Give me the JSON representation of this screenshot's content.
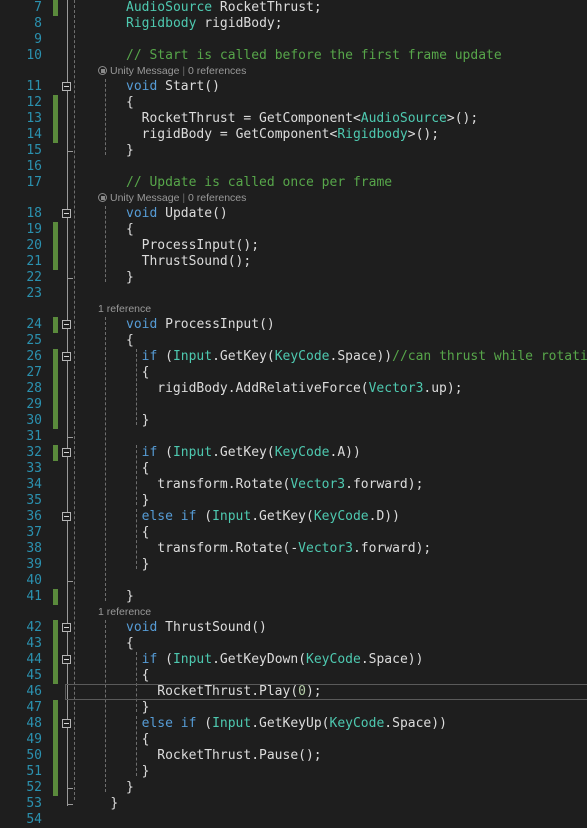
{
  "editor": {
    "name": "visual-studio-code-editor",
    "language": "csharp",
    "background_color": "#1e1e1e",
    "line_number_color": "#2b91af",
    "change_bar_color": "#5a8a3c",
    "current_line": 46,
    "first_line": 7,
    "last_line": 54,
    "colors": {
      "keyword": "#569cd6",
      "type": "#4ec9b0",
      "comment": "#57a64a",
      "identifier": "#dcdcdc",
      "number": "#b5cea8",
      "codelens": "#999999"
    },
    "codelens": [
      {
        "above_line": 11,
        "icon": "unity-message-icon",
        "label": "Unity Message",
        "separator": "|",
        "references": "0 references"
      },
      {
        "above_line": 18,
        "icon": "unity-message-icon",
        "label": "Unity Message",
        "separator": "|",
        "references": "0 references"
      },
      {
        "above_line": 24,
        "icon": null,
        "label": null,
        "separator": null,
        "references": "1 reference"
      },
      {
        "above_line": 42,
        "icon": null,
        "label": null,
        "separator": null,
        "references": "1 reference"
      }
    ],
    "lines": [
      {
        "n": 7,
        "indent": 2,
        "changed": true,
        "fold": null,
        "tokens": [
          {
            "t": "AudioSource",
            "c": "type"
          },
          {
            "t": " ",
            "c": "punc"
          },
          {
            "t": "RocketThrust;",
            "c": "id"
          }
        ]
      },
      {
        "n": 8,
        "indent": 2,
        "changed": false,
        "fold": null,
        "tokens": [
          {
            "t": "Rigidbody",
            "c": "type"
          },
          {
            "t": " ",
            "c": "punc"
          },
          {
            "t": "rigidBody;",
            "c": "id"
          }
        ]
      },
      {
        "n": 9,
        "indent": 2,
        "changed": false,
        "fold": null,
        "tokens": []
      },
      {
        "n": 10,
        "indent": 2,
        "changed": false,
        "fold": null,
        "tokens": [
          {
            "t": "// Start is called before the first frame update",
            "c": "cmt"
          }
        ]
      },
      {
        "n": 11,
        "indent": 2,
        "changed": false,
        "fold": "open",
        "tokens": [
          {
            "t": "void",
            "c": "kw"
          },
          {
            "t": " ",
            "c": "punc"
          },
          {
            "t": "Start",
            "c": "id"
          },
          {
            "t": "()",
            "c": "punc"
          }
        ]
      },
      {
        "n": 12,
        "indent": 2,
        "changed": true,
        "fold": null,
        "tokens": [
          {
            "t": "{",
            "c": "punc"
          }
        ]
      },
      {
        "n": 13,
        "indent": 3,
        "changed": true,
        "fold": null,
        "tokens": [
          {
            "t": "RocketThrust ",
            "c": "id"
          },
          {
            "t": "= ",
            "c": "punc"
          },
          {
            "t": "GetComponent",
            "c": "id"
          },
          {
            "t": "<",
            "c": "punc"
          },
          {
            "t": "AudioSource",
            "c": "type"
          },
          {
            "t": ">();",
            "c": "punc"
          }
        ]
      },
      {
        "n": 14,
        "indent": 3,
        "changed": true,
        "fold": null,
        "tokens": [
          {
            "t": "rigidBody ",
            "c": "id"
          },
          {
            "t": "= ",
            "c": "punc"
          },
          {
            "t": "GetComponent",
            "c": "id"
          },
          {
            "t": "<",
            "c": "punc"
          },
          {
            "t": "Rigidbody",
            "c": "type"
          },
          {
            "t": ">();",
            "c": "punc"
          }
        ]
      },
      {
        "n": 15,
        "indent": 2,
        "changed": false,
        "fold": "end",
        "tokens": [
          {
            "t": "}",
            "c": "punc"
          }
        ]
      },
      {
        "n": 16,
        "indent": 2,
        "changed": false,
        "fold": null,
        "tokens": []
      },
      {
        "n": 17,
        "indent": 2,
        "changed": false,
        "fold": null,
        "tokens": [
          {
            "t": "// Update is called once per frame",
            "c": "cmt"
          }
        ]
      },
      {
        "n": 18,
        "indent": 2,
        "changed": false,
        "fold": "open",
        "tokens": [
          {
            "t": "void",
            "c": "kw"
          },
          {
            "t": " ",
            "c": "punc"
          },
          {
            "t": "Update",
            "c": "id"
          },
          {
            "t": "()",
            "c": "punc"
          }
        ]
      },
      {
        "n": 19,
        "indent": 2,
        "changed": true,
        "fold": null,
        "tokens": [
          {
            "t": "{",
            "c": "punc"
          }
        ]
      },
      {
        "n": 20,
        "indent": 3,
        "changed": true,
        "fold": null,
        "tokens": [
          {
            "t": "ProcessInput",
            "c": "id"
          },
          {
            "t": "();",
            "c": "punc"
          }
        ]
      },
      {
        "n": 21,
        "indent": 3,
        "changed": true,
        "fold": null,
        "tokens": [
          {
            "t": "ThrustSound",
            "c": "id"
          },
          {
            "t": "();",
            "c": "punc"
          }
        ]
      },
      {
        "n": 22,
        "indent": 2,
        "changed": false,
        "fold": "end",
        "tokens": [
          {
            "t": "}",
            "c": "punc"
          }
        ]
      },
      {
        "n": 23,
        "indent": 2,
        "changed": false,
        "fold": null,
        "tokens": []
      },
      {
        "n": 24,
        "indent": 2,
        "changed": true,
        "fold": "open",
        "tokens": [
          {
            "t": "void",
            "c": "kw"
          },
          {
            "t": " ",
            "c": "punc"
          },
          {
            "t": "ProcessInput",
            "c": "id"
          },
          {
            "t": "()",
            "c": "punc"
          }
        ]
      },
      {
        "n": 25,
        "indent": 2,
        "changed": false,
        "fold": null,
        "tokens": [
          {
            "t": "{",
            "c": "punc"
          }
        ]
      },
      {
        "n": 26,
        "indent": 3,
        "changed": true,
        "fold": "open",
        "tokens": [
          {
            "t": "if",
            "c": "kw"
          },
          {
            "t": " (",
            "c": "punc"
          },
          {
            "t": "Input",
            "c": "type"
          },
          {
            "t": ".",
            "c": "punc"
          },
          {
            "t": "GetKey",
            "c": "id"
          },
          {
            "t": "(",
            "c": "punc"
          },
          {
            "t": "KeyCode",
            "c": "type"
          },
          {
            "t": ".",
            "c": "punc"
          },
          {
            "t": "Space",
            "c": "id"
          },
          {
            "t": "))",
            "c": "punc"
          },
          {
            "t": "//can thrust while rotating",
            "c": "cmt"
          }
        ]
      },
      {
        "n": 27,
        "indent": 3,
        "changed": true,
        "fold": null,
        "tokens": [
          {
            "t": "{",
            "c": "punc"
          }
        ]
      },
      {
        "n": 28,
        "indent": 4,
        "changed": true,
        "fold": null,
        "tokens": [
          {
            "t": "rigidBody",
            "c": "id"
          },
          {
            "t": ".",
            "c": "punc"
          },
          {
            "t": "AddRelativeForce",
            "c": "id"
          },
          {
            "t": "(",
            "c": "punc"
          },
          {
            "t": "Vector3",
            "c": "type"
          },
          {
            "t": ".",
            "c": "punc"
          },
          {
            "t": "up);",
            "c": "id"
          }
        ]
      },
      {
        "n": 29,
        "indent": 4,
        "changed": true,
        "fold": null,
        "tokens": []
      },
      {
        "n": 30,
        "indent": 3,
        "changed": true,
        "fold": null,
        "tokens": [
          {
            "t": "}",
            "c": "punc"
          }
        ]
      },
      {
        "n": 31,
        "indent": 3,
        "changed": false,
        "fold": "end",
        "tokens": []
      },
      {
        "n": 32,
        "indent": 3,
        "changed": true,
        "fold": "open",
        "tokens": [
          {
            "t": "if",
            "c": "kw"
          },
          {
            "t": " (",
            "c": "punc"
          },
          {
            "t": "Input",
            "c": "type"
          },
          {
            "t": ".",
            "c": "punc"
          },
          {
            "t": "GetKey",
            "c": "id"
          },
          {
            "t": "(",
            "c": "punc"
          },
          {
            "t": "KeyCode",
            "c": "type"
          },
          {
            "t": ".",
            "c": "punc"
          },
          {
            "t": "A",
            "c": "id"
          },
          {
            "t": "))",
            "c": "punc"
          }
        ]
      },
      {
        "n": 33,
        "indent": 3,
        "changed": false,
        "fold": null,
        "tokens": [
          {
            "t": "{",
            "c": "punc"
          }
        ]
      },
      {
        "n": 34,
        "indent": 4,
        "changed": false,
        "fold": null,
        "tokens": [
          {
            "t": "transform",
            "c": "id"
          },
          {
            "t": ".",
            "c": "punc"
          },
          {
            "t": "Rotate",
            "c": "id"
          },
          {
            "t": "(",
            "c": "punc"
          },
          {
            "t": "Vector3",
            "c": "type"
          },
          {
            "t": ".",
            "c": "punc"
          },
          {
            "t": "forward);",
            "c": "id"
          }
        ]
      },
      {
        "n": 35,
        "indent": 3,
        "changed": false,
        "fold": null,
        "tokens": [
          {
            "t": "}",
            "c": "punc"
          }
        ]
      },
      {
        "n": 36,
        "indent": 3,
        "changed": false,
        "fold": "open",
        "tokens": [
          {
            "t": "else",
            "c": "kw"
          },
          {
            "t": " ",
            "c": "punc"
          },
          {
            "t": "if",
            "c": "kw"
          },
          {
            "t": " (",
            "c": "punc"
          },
          {
            "t": "Input",
            "c": "type"
          },
          {
            "t": ".",
            "c": "punc"
          },
          {
            "t": "GetKey",
            "c": "id"
          },
          {
            "t": "(",
            "c": "punc"
          },
          {
            "t": "KeyCode",
            "c": "type"
          },
          {
            "t": ".",
            "c": "punc"
          },
          {
            "t": "D",
            "c": "id"
          },
          {
            "t": "))",
            "c": "punc"
          }
        ]
      },
      {
        "n": 37,
        "indent": 3,
        "changed": false,
        "fold": null,
        "tokens": [
          {
            "t": "{",
            "c": "punc"
          }
        ]
      },
      {
        "n": 38,
        "indent": 4,
        "changed": false,
        "fold": null,
        "tokens": [
          {
            "t": "transform",
            "c": "id"
          },
          {
            "t": ".",
            "c": "punc"
          },
          {
            "t": "Rotate",
            "c": "id"
          },
          {
            "t": "(-",
            "c": "punc"
          },
          {
            "t": "Vector3",
            "c": "type"
          },
          {
            "t": ".",
            "c": "punc"
          },
          {
            "t": "forward);",
            "c": "id"
          }
        ]
      },
      {
        "n": 39,
        "indent": 3,
        "changed": false,
        "fold": null,
        "tokens": [
          {
            "t": "}",
            "c": "punc"
          }
        ]
      },
      {
        "n": 40,
        "indent": 3,
        "changed": false,
        "fold": "end",
        "tokens": []
      },
      {
        "n": 41,
        "indent": 2,
        "changed": true,
        "fold": null,
        "tokens": [
          {
            "t": "}",
            "c": "punc"
          }
        ]
      },
      {
        "n": 42,
        "indent": 2,
        "changed": true,
        "fold": "open",
        "tokens": [
          {
            "t": "void",
            "c": "kw"
          },
          {
            "t": " ",
            "c": "punc"
          },
          {
            "t": "ThrustSound",
            "c": "id"
          },
          {
            "t": "()",
            "c": "punc"
          }
        ]
      },
      {
        "n": 43,
        "indent": 2,
        "changed": true,
        "fold": null,
        "tokens": [
          {
            "t": "{",
            "c": "punc"
          }
        ]
      },
      {
        "n": 44,
        "indent": 3,
        "changed": true,
        "fold": "open",
        "tokens": [
          {
            "t": "if",
            "c": "kw"
          },
          {
            "t": " (",
            "c": "punc"
          },
          {
            "t": "Input",
            "c": "type"
          },
          {
            "t": ".",
            "c": "punc"
          },
          {
            "t": "GetKeyDown",
            "c": "id"
          },
          {
            "t": "(",
            "c": "punc"
          },
          {
            "t": "KeyCode",
            "c": "type"
          },
          {
            "t": ".",
            "c": "punc"
          },
          {
            "t": "Space",
            "c": "id"
          },
          {
            "t": "))",
            "c": "punc"
          }
        ]
      },
      {
        "n": 45,
        "indent": 3,
        "changed": true,
        "fold": null,
        "tokens": [
          {
            "t": "{",
            "c": "punc"
          }
        ]
      },
      {
        "n": 46,
        "indent": 4,
        "changed": false,
        "fold": null,
        "tokens": [
          {
            "t": "RocketThrust",
            "c": "id"
          },
          {
            "t": ".",
            "c": "punc"
          },
          {
            "t": "Play",
            "c": "id"
          },
          {
            "t": "(",
            "c": "punc"
          },
          {
            "t": "0",
            "c": "num"
          },
          {
            "t": ");",
            "c": "punc"
          }
        ]
      },
      {
        "n": 47,
        "indent": 3,
        "changed": true,
        "fold": null,
        "tokens": [
          {
            "t": "}",
            "c": "punc"
          }
        ]
      },
      {
        "n": 48,
        "indent": 3,
        "changed": true,
        "fold": "open",
        "tokens": [
          {
            "t": "else",
            "c": "kw"
          },
          {
            "t": " ",
            "c": "punc"
          },
          {
            "t": "if",
            "c": "kw"
          },
          {
            "t": " (",
            "c": "punc"
          },
          {
            "t": "Input",
            "c": "type"
          },
          {
            "t": ".",
            "c": "punc"
          },
          {
            "t": "GetKeyUp",
            "c": "id"
          },
          {
            "t": "(",
            "c": "punc"
          },
          {
            "t": "KeyCode",
            "c": "type"
          },
          {
            "t": ".",
            "c": "punc"
          },
          {
            "t": "Space",
            "c": "id"
          },
          {
            "t": "))",
            "c": "punc"
          }
        ]
      },
      {
        "n": 49,
        "indent": 3,
        "changed": true,
        "fold": null,
        "tokens": [
          {
            "t": "{",
            "c": "punc"
          }
        ]
      },
      {
        "n": 50,
        "indent": 4,
        "changed": true,
        "fold": null,
        "tokens": [
          {
            "t": "RocketThrust",
            "c": "id"
          },
          {
            "t": ".",
            "c": "punc"
          },
          {
            "t": "Pause",
            "c": "id"
          },
          {
            "t": "();",
            "c": "punc"
          }
        ]
      },
      {
        "n": 51,
        "indent": 3,
        "changed": true,
        "fold": null,
        "tokens": [
          {
            "t": "}",
            "c": "punc"
          }
        ]
      },
      {
        "n": 52,
        "indent": 2,
        "changed": true,
        "fold": "end",
        "tokens": [
          {
            "t": "}",
            "c": "punc"
          }
        ]
      },
      {
        "n": 53,
        "indent": 1,
        "changed": false,
        "fold": "end",
        "tokens": [
          {
            "t": "}",
            "c": "punc"
          }
        ]
      },
      {
        "n": 54,
        "indent": 0,
        "changed": false,
        "fold": null,
        "tokens": []
      }
    ]
  }
}
